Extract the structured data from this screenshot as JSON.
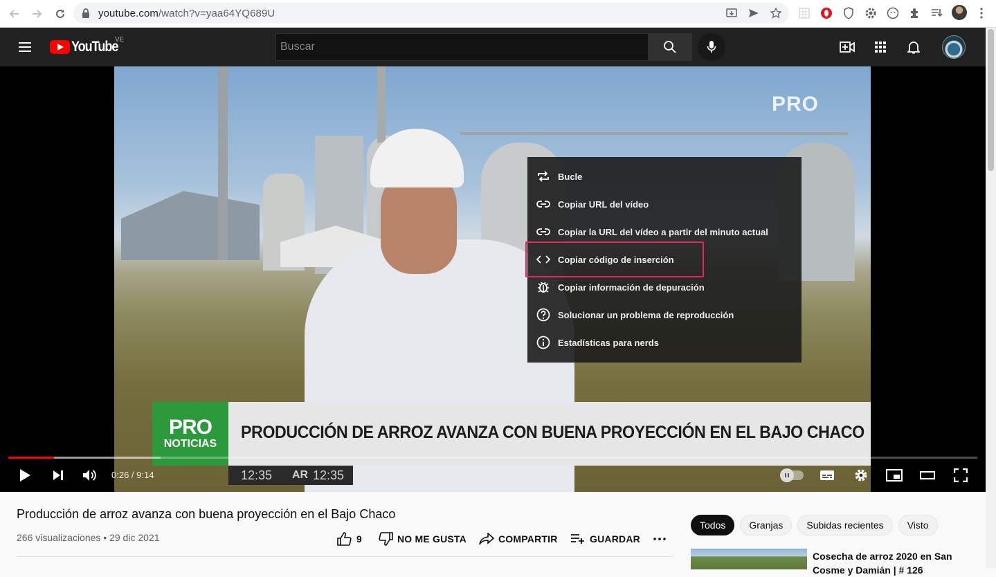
{
  "browser": {
    "url_host": "youtube.com",
    "url_path": "/watch?v=yaa64YQ689U"
  },
  "masthead": {
    "logo_text": "YouTube",
    "country_code": "VE",
    "search_placeholder": "Buscar"
  },
  "player": {
    "watermark": "PRO",
    "lower_third": {
      "logo_top": "PRO",
      "logo_bottom": "NOTICIAS",
      "headline": "PRODUCCIÓN DE ARROZ AVANZA CON BUENA PROYECCIÓN EN EL BAJO CHACO",
      "clock_left": "12:35",
      "clock_region": "AR",
      "clock_right": "12:35"
    },
    "time_display": "0:26 / 9:14",
    "progress_played": 0.047,
    "progress_loaded": 0.157,
    "context_menu": [
      {
        "label": "Bucle",
        "icon": "loop-icon"
      },
      {
        "label": "Copiar URL del vídeo",
        "icon": "link-icon"
      },
      {
        "label": "Copiar la URL del vídeo a partir del minuto actual",
        "icon": "link-icon"
      },
      {
        "label": "Copiar código de inserción",
        "icon": "embed-code-icon"
      },
      {
        "label": "Copiar información de depuración",
        "icon": "debug-bug-icon"
      },
      {
        "label": "Solucionar un problema de reproducción",
        "icon": "help-circle-icon"
      },
      {
        "label": "Estadísticas para nerds",
        "icon": "info-circle-icon"
      }
    ],
    "highlighted_item_index": 3,
    "highlight_color": "#e8245a"
  },
  "video": {
    "title": "Producción de arroz avanza con buena proyección en el Bajo Chaco",
    "meta": "266 visualizaciones • 29 dic 2021",
    "like_count": "9",
    "dislike_label": "NO ME GUSTA",
    "share_label": "COMPARTIR",
    "save_label": "GUARDAR"
  },
  "sidebar": {
    "chips": [
      {
        "label": "Todos",
        "active": true
      },
      {
        "label": "Granjas",
        "active": false
      },
      {
        "label": "Subidas recientes",
        "active": false
      },
      {
        "label": "Visto",
        "active": false
      }
    ],
    "recommendation": {
      "title": "Cosecha de arroz 2020 en San Cosme y Damián | # 126"
    }
  },
  "colors": {
    "yt_red": "#ff0000",
    "masthead_bg": "#212121",
    "news_green": "#2c9a3c"
  }
}
